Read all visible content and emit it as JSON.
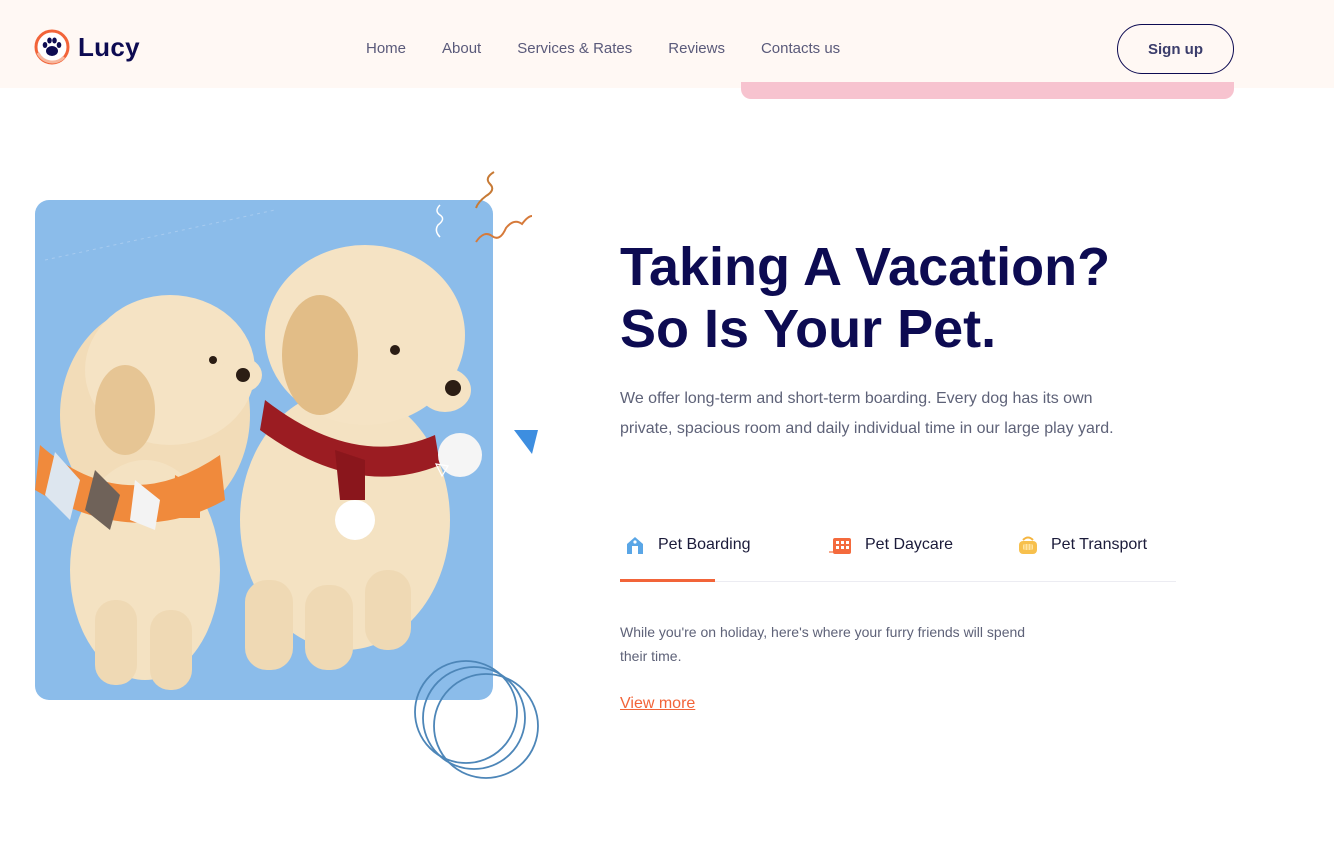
{
  "brand": {
    "name": "Lucy",
    "logo_icon": "paw-logo-icon"
  },
  "nav": {
    "items": [
      {
        "label": "Home"
      },
      {
        "label": "About"
      },
      {
        "label": "Services & Rates"
      },
      {
        "label": "Reviews"
      },
      {
        "label": "Contacts us"
      }
    ],
    "signup_label": "Sign up"
  },
  "hero": {
    "title_line1": "Taking A Vacation?",
    "title_line2": "So Is Your Pet.",
    "description": "We offer long-term and short-term boarding. Every dog has its own private, spacious room and daily individual time in our large play yard.",
    "image_alt": "two puppies wearing scarves"
  },
  "tabs": [
    {
      "label": "Pet Boarding",
      "icon": "house-icon",
      "active": true
    },
    {
      "label": "Pet Daycare",
      "icon": "daycare-icon",
      "active": false
    },
    {
      "label": "Pet Transport",
      "icon": "pet-carrier-icon",
      "active": false
    }
  ],
  "tab_content": {
    "text": "While you're on holiday, here's where your furry friends will spend their time.",
    "link_label": "View more"
  },
  "colors": {
    "navy": "#0d0b52",
    "accent": "#f26439",
    "header_bg": "#fff8f4",
    "image_bg": "#8bbcea",
    "pink": "#f7c3cf"
  }
}
